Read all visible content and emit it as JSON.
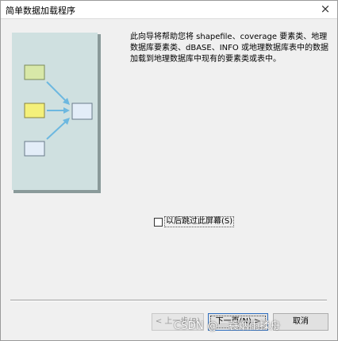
{
  "window": {
    "title": "简单数据加载程序",
    "close_glyph": "×"
  },
  "intro": {
    "description": "此向导将帮助您将 shapefile、coverage 要素类、地理数据库要素类、dBASE、INFO 或地理数据库表中的数据加载到地理数据库中现有的要素类或表中。"
  },
  "options": {
    "skip_label": "以后跳过此屏幕(S)",
    "skip_checked": false
  },
  "buttons": {
    "back_label": "< 上一步(B)",
    "next_label": "下一页(N) >",
    "cancel_label": "取消"
  },
  "watermark": {
    "text": "CSDN @一蓑烟雨揉舟"
  },
  "colors": {
    "illustration_bg": "#cfe0e0",
    "box_green": "#d8e8a8",
    "box_yellow": "#f4f07a",
    "box_blue": "#e3edf8",
    "arrow": "#6db8e0"
  },
  "icons": [
    "close-icon",
    "data-flow-illustration",
    "checkbox-icon"
  ]
}
